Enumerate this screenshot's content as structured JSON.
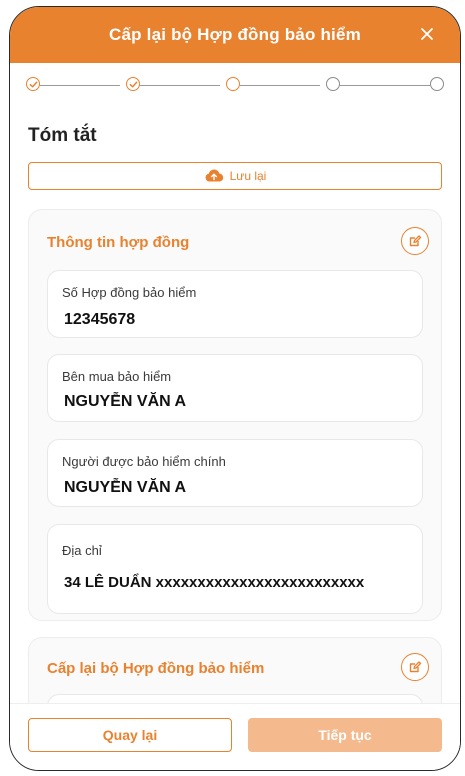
{
  "header": {
    "title": "Cấp lại bộ Hợp đồng bảo hiểm",
    "close_icon": "close-icon"
  },
  "stepper": {
    "total_steps": 5,
    "steps": [
      {
        "state": "done",
        "icon": "check-circle-icon"
      },
      {
        "state": "done",
        "icon": "check-circle-icon"
      },
      {
        "state": "current",
        "icon": "circle-icon"
      },
      {
        "state": "todo",
        "icon": "circle-icon"
      },
      {
        "state": "todo",
        "icon": "circle-icon"
      }
    ]
  },
  "summary": {
    "title": "Tóm tắt",
    "save_label": "Lưu lại",
    "save_icon": "cloud-upload-icon"
  },
  "contract_card": {
    "title": "Thông tin hợp đồng",
    "edit_icon": "edit-icon",
    "fields": [
      {
        "label": "Số Hợp đồng bảo hiểm",
        "value": "12345678"
      },
      {
        "label": "Bên mua bảo hiểm",
        "value": "NGUYỄN VĂN A"
      },
      {
        "label": "Người được bảo hiểm chính",
        "value": "NGUYỄN VĂN A"
      },
      {
        "label": "Địa chỉ",
        "value": "34 LÊ DUẨN xxxxxxxxxxxxxxxxxxxxxxxxx"
      }
    ]
  },
  "reissue_card": {
    "title": "Cấp lại bộ Hợp đồng bảo hiểm",
    "edit_icon": "edit-icon"
  },
  "footer": {
    "back_label": "Quay lại",
    "next_label": "Tiếp tục"
  },
  "colors": {
    "accent": "#e8822f",
    "accent_disabled": "#f5b98e",
    "text": "#222222"
  }
}
